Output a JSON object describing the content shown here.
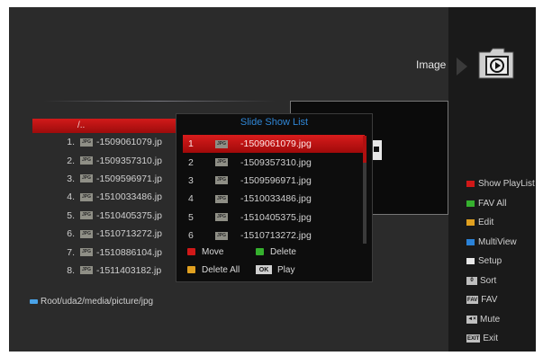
{
  "header": {
    "title": "Image",
    "icon": "media-folder-icon"
  },
  "file_list": {
    "path_label": "/..",
    "items": [
      {
        "num": "1.",
        "name": "-1509061079.jp"
      },
      {
        "num": "2.",
        "name": "-1509357310.jp"
      },
      {
        "num": "3.",
        "name": "-1509596971.jp"
      },
      {
        "num": "4.",
        "name": "-1510033486.jp"
      },
      {
        "num": "5.",
        "name": "-1510405375.jp"
      },
      {
        "num": "6.",
        "name": "-1510713272.jp"
      },
      {
        "num": "7.",
        "name": "-1510886104.jp"
      },
      {
        "num": "8.",
        "name": "-1511403182.jp"
      }
    ]
  },
  "status": {
    "path": "Root/uda2/media/picture/jpg"
  },
  "dialog": {
    "title": "Slide Show List",
    "items": [
      {
        "num": "1",
        "name": "-1509061079.jpg"
      },
      {
        "num": "2",
        "name": "-1509357310.jpg"
      },
      {
        "num": "3",
        "name": "-1509596971.jpg"
      },
      {
        "num": "4",
        "name": "-1510033486.jpg"
      },
      {
        "num": "5",
        "name": "-1510405375.jpg"
      },
      {
        "num": "6",
        "name": "-1510713272.jpg"
      }
    ],
    "actions": {
      "move": "Move",
      "delete": "Delete",
      "delete_all": "Delete All",
      "play_key": "OK",
      "play": "Play"
    }
  },
  "legend": {
    "show_playlist": "Show PlayList",
    "fav_all": "FAV All",
    "edit": "Edit",
    "multiview": "MultiView",
    "setup": "Setup",
    "sort_key": "0",
    "sort": "Sort",
    "fav_key": "FAV",
    "fav": "FAV",
    "mute_key": "◄×",
    "mute": "Mute",
    "exit_key": "EXIT",
    "exit": "Exit"
  },
  "icon_label": "JPG",
  "colors": {
    "red": "#d01818",
    "green": "#35b02e",
    "yellow": "#e0a020",
    "blue": "#2a82d8",
    "white": "#e8e8e8",
    "title_blue": "#2f86d6"
  }
}
